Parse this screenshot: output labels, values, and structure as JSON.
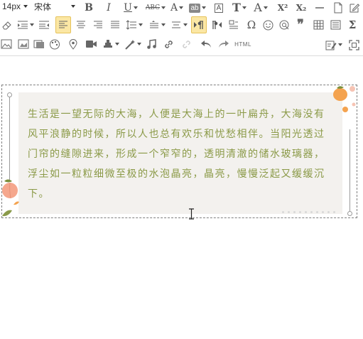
{
  "toolbar": {
    "font_size": "14px",
    "font_family": "宋体",
    "bold": "B",
    "italic": "I",
    "underline": "U",
    "strike": "ABC",
    "font_color": "A",
    "highlight": "ab",
    "box": "A",
    "text_size": "T",
    "font_style": "A",
    "superscript": "X²",
    "subscript": "X₂",
    "omega": "Ω",
    "quote": "❞",
    "sum": "Σ",
    "html": "HTML"
  },
  "colors": {
    "text": "#8b9a48",
    "paper": "#f3f1ee",
    "active_bg": "#fbe7a4",
    "peach": "#f4a34f",
    "pink_fruit": "#f5a78d"
  },
  "editor": {
    "paragraph": "生活是一望无际的大海，人便是大海上的一叶扁舟，大海没有风平浪静的时候，所以人也总有欢乐和忧愁相伴。当阳光透过门帘的缝隙进来，形成一个窄窄的，透明清澈的储水玻璃器，浮尘如一粒粒细微至极的水泡晶亮，晶亮，慢慢泛起又缓缓沉下。"
  }
}
